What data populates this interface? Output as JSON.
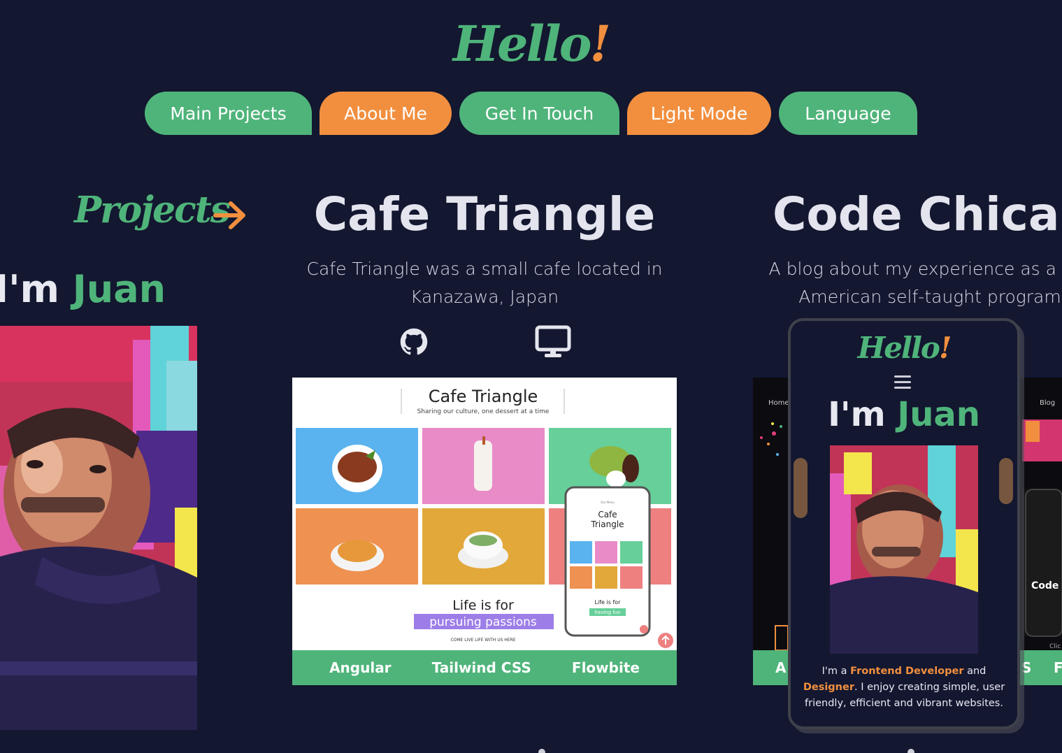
{
  "header": {
    "logo_main": "Hello",
    "logo_mark": "!"
  },
  "nav": {
    "main_projects": "Main Projects",
    "about_me": "About Me",
    "get_in_touch": "Get In Touch",
    "light_mode": "Light Mode",
    "language": "Language"
  },
  "intro": {
    "projects_heading": "Projects",
    "im_prefix": "I'm ",
    "name": "Juan"
  },
  "project_card": {
    "title": "Cafe Triangle",
    "description": "Cafe Triangle was a small cafe located in Kanazawa, Japan",
    "icons": [
      "github-icon",
      "monitor-icon"
    ],
    "screenshot": {
      "site_title": "Cafe Triangle",
      "site_tagline": "Sharing our culture, one dessert at a time",
      "life_text": "Life is for",
      "highlight_text": "pursuing passions",
      "footer_text": "COME LIVE LIFE WITH US HERE",
      "mobile_title_line1": "Cafe",
      "mobile_title_line2": "Triangle",
      "mobile_life_text": "Life is for",
      "mobile_highlight": "having fun",
      "mobile_nav": "Our Menu"
    },
    "tech": [
      "Angular",
      "Tailwind CSS",
      "Flowbite"
    ]
  },
  "project_card_2": {
    "title": "Code Chica",
    "description_line1": "A blog about my experience as a M",
    "description_line2": "American self-taught program",
    "bar_left": "A",
    "bar_right_1": "S",
    "bar_right_2": "F",
    "preview_home": "Home",
    "preview_blog": "Blog",
    "preview_code": "Code C",
    "preview_click": "Clic"
  },
  "phone_preview": {
    "logo_main": "Hello",
    "logo_mark": "!",
    "im_prefix": "I'm ",
    "name": "Juan",
    "bio_prefix": "I'm a ",
    "role": "Frontend Developer",
    "bio_and": " and ",
    "role2": "Designer",
    "bio_rest": ". I enjoy creating simple, user friendly, efficient and vibrant websites."
  },
  "colors": {
    "background": "#131730",
    "green": "#4fb47a",
    "orange": "#f28f3f"
  }
}
